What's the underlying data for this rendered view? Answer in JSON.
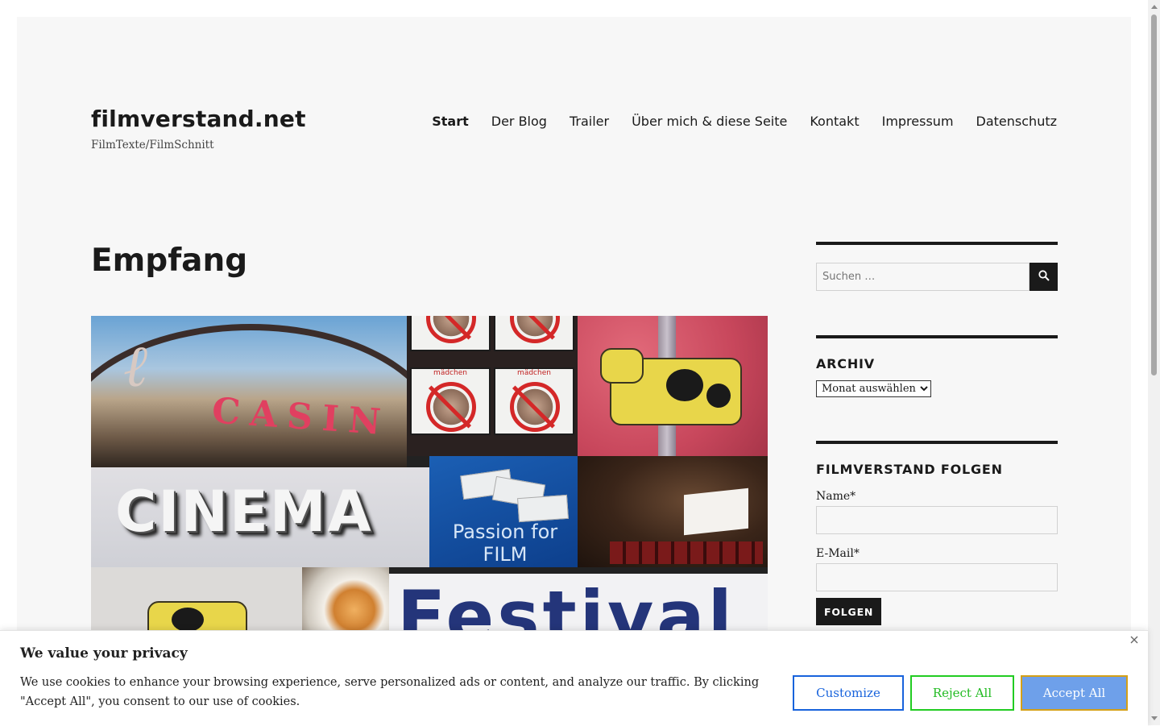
{
  "site": {
    "title": "filmverstand.net",
    "description": "FilmTexte/FilmSchnitt"
  },
  "nav": {
    "items": [
      {
        "label": "Start",
        "active": true
      },
      {
        "label": "Der Blog"
      },
      {
        "label": "Trailer"
      },
      {
        "label": "Über mich & diese Seite"
      },
      {
        "label": "Kontakt"
      },
      {
        "label": "Impressum"
      },
      {
        "label": "Datenschutz"
      }
    ]
  },
  "page": {
    "title": "Empfang",
    "collage_texts": {
      "cinema": "CINEMA",
      "festival": "Festival",
      "passion": "Passion for FILM",
      "casino": "CASIN",
      "maedchen": "mädchen"
    }
  },
  "sidebar": {
    "search": {
      "placeholder": "Suchen …",
      "icon": "search-icon"
    },
    "archive": {
      "title": "ARCHIV",
      "select_value": "Monat auswählen"
    },
    "follow": {
      "title": "FILMVERSTAND FOLGEN",
      "name_label": "Name*",
      "email_label": "E-Mail*",
      "button_label": "FOLGEN"
    }
  },
  "cookie": {
    "title": "We value your privacy",
    "text": "We use cookies to enhance your browsing experience, serve personalized ads or content, and analyze our traffic. By clicking \"Accept All\", you consent to our use of cookies.",
    "customize_label": "Customize",
    "reject_label": "Reject All",
    "accept_label": "Accept All",
    "colors": {
      "customize": "#1863dc",
      "reject": "#22cc22",
      "accept_bg": "#6ea0ea",
      "accept_border": "#d4a017"
    }
  }
}
